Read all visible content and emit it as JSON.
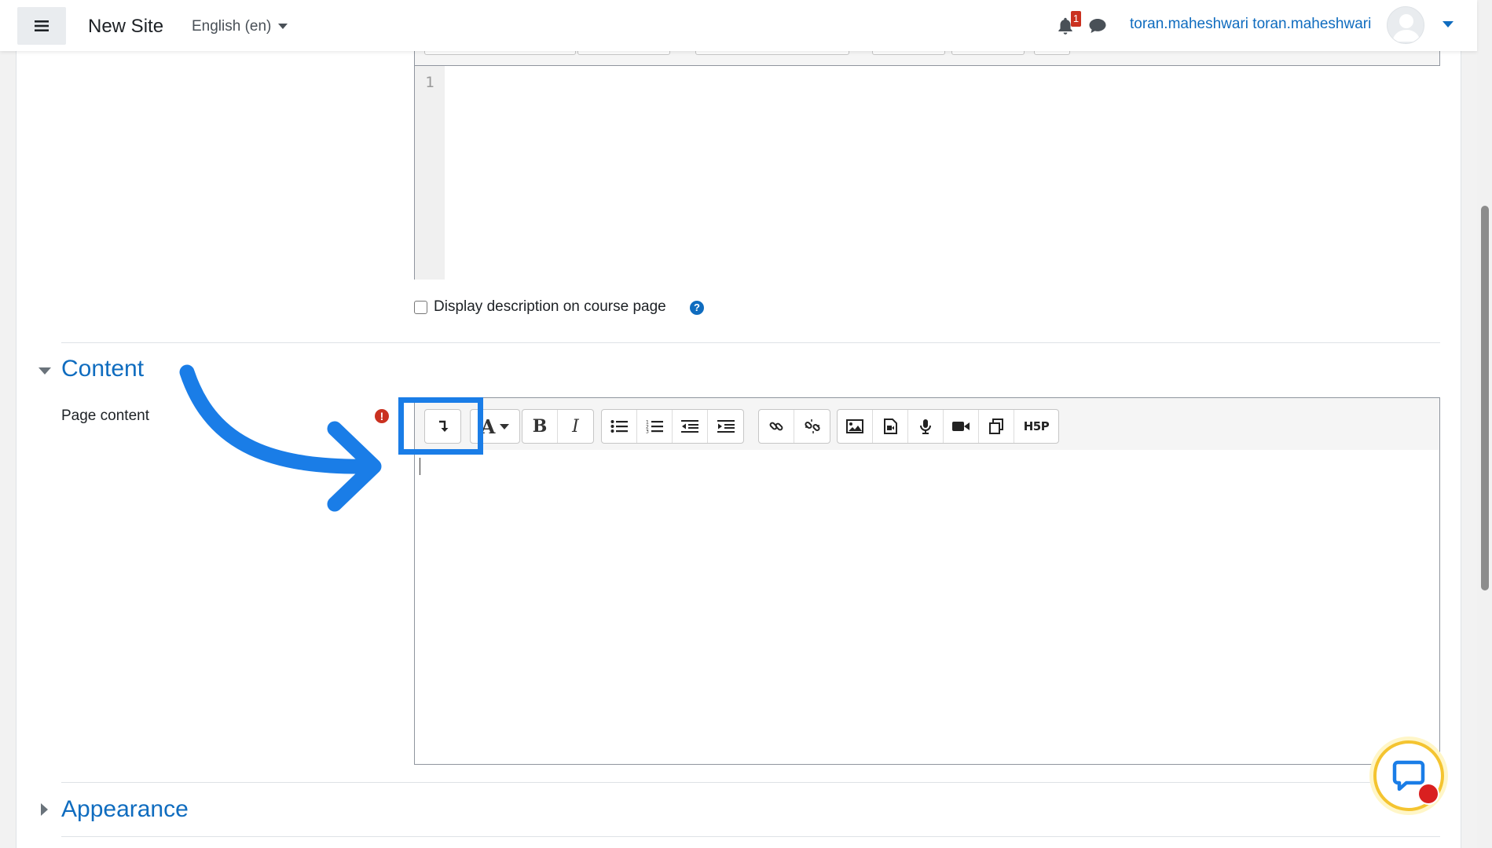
{
  "navbar": {
    "site_name": "New Site",
    "language": "English (en)",
    "notification_count": "1",
    "user_name": "toran.maheshwari toran.maheshwari"
  },
  "description_editor": {
    "line_number": "1"
  },
  "display_description": {
    "label": "Display description on course page",
    "checked": false,
    "help_icon": "?"
  },
  "content_section": {
    "heading": "Content",
    "page_content_label": "Page content",
    "required_icon": "!",
    "toolbar": {
      "icons": [
        "toolbar-toggle-icon",
        "font-color-icon",
        "bold-icon",
        "italic-icon",
        "unordered-list-icon",
        "ordered-list-icon",
        "outdent-icon",
        "indent-icon",
        "link-icon",
        "unlink-icon",
        "image-icon",
        "media-icon",
        "record-audio-icon",
        "record-video-icon",
        "manage-files-icon",
        "h5p-icon"
      ],
      "bold_label": "B",
      "italic_label": "I",
      "font_label": "A",
      "h5p_label": "H5P"
    }
  },
  "appearance_section": {
    "heading": "Appearance"
  },
  "colors": {
    "link": "#0f6cbf",
    "annotation": "#1a7de7",
    "required": "#ca3120",
    "chat_ring": "#f4c430"
  }
}
